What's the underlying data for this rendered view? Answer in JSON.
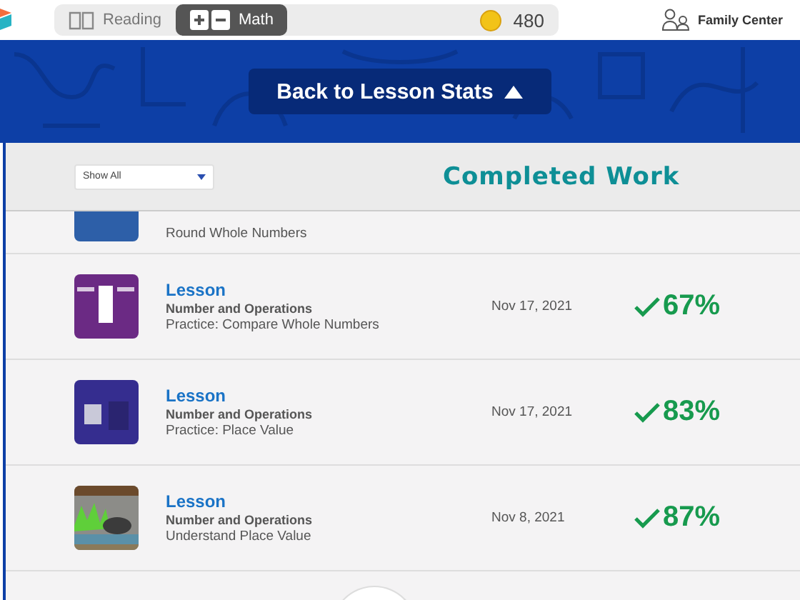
{
  "subjects": [
    {
      "label": "Reading",
      "selected": false
    },
    {
      "label": "Math",
      "selected": true
    }
  ],
  "coins": "480",
  "family_center": "Family Center",
  "back_button": "Back to Lesson Stats",
  "filter": {
    "value": "Show All"
  },
  "title": "Completed Work",
  "partial_row": {
    "subtitle": "Round Whole Numbers"
  },
  "rows": [
    {
      "type": "Lesson",
      "topic": "Number and Operations",
      "name": "Practice: Compare Whole Numbers",
      "date": "Nov 17, 2021",
      "score": "67%"
    },
    {
      "type": "Lesson",
      "topic": "Number and Operations",
      "name": "Practice: Place Value",
      "date": "Nov 17, 2021",
      "score": "83%"
    },
    {
      "type": "Lesson",
      "topic": "Number and Operations",
      "name": "Understand Place Value",
      "date": "Nov 8, 2021",
      "score": "87%"
    }
  ]
}
